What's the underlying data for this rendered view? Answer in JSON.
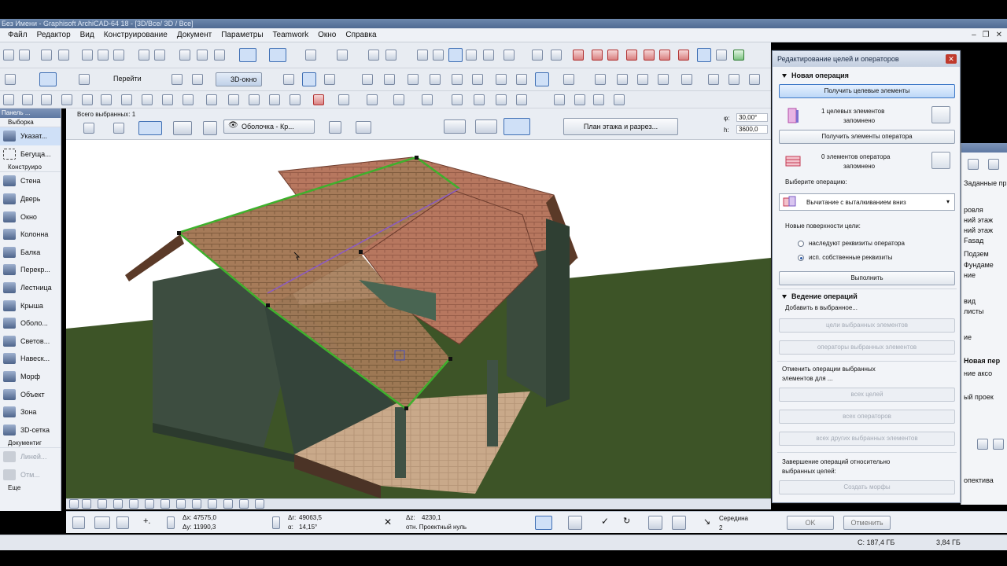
{
  "window": {
    "title": "Без Имени - Graphisoft ArchiCAD-64 18 - [3D/Все/ 3D / Все]"
  },
  "menu": [
    "Файл",
    "Редактор",
    "Вид",
    "Конструирование",
    "Документ",
    "Параметры",
    "Teamwork",
    "Окно",
    "Справка"
  ],
  "toolbar": {
    "navigate_label": "Перейти",
    "view3d_label": "3D-окно",
    "floorplan_label": "План этажа и разрез..."
  },
  "infobox": {
    "selected": "Всего выбранных: 1",
    "shell_label": "Оболочка - Кр...",
    "angle_label": "φ:",
    "angle_value": "30,00°",
    "height_label": "h:",
    "height_value": "3600,0"
  },
  "toolbox": {
    "header": "Панель ...",
    "select_section": "Выборка",
    "items_top": [
      {
        "label": "Указат...",
        "selected": true
      },
      {
        "label": "Бегуща...",
        "selected": false
      }
    ],
    "design_section": "Конструиро",
    "design_items": [
      "Стена",
      "Дверь",
      "Окно",
      "Колонна",
      "Балка",
      "Перекр...",
      "Лестница",
      "Крыша",
      "Оболо...",
      "Светов...",
      "Навеск...",
      "Морф",
      "Объект",
      "Зона",
      "3D-сетка"
    ],
    "doc_section": "Документиг",
    "doc_items": [
      "Линей...",
      "Отм..."
    ],
    "more": "Еще"
  },
  "coordbar": {
    "ax_label": "Δx:",
    "ax_value": "47575,0",
    "ay_label": "Δy:",
    "ay_value": "11990,3",
    "r_label": "Δr:",
    "r_value": "49063,5",
    "a_label": "α:",
    "a_value": "14,15°",
    "z_label": "Δz:",
    "z_value": "4230,1",
    "ref_label": "отн. Проектный нуль",
    "snap_label": "Середина",
    "snap_value": "2",
    "ok_label": "OK",
    "cancel_label": "Отменить"
  },
  "statusbar": {
    "disk_c": "C: 187,4 ГБ",
    "disk_mem": "3,84 ГБ"
  },
  "dialog": {
    "title": "Редактирование целей и операторов",
    "new_op_header": "Новая операция",
    "get_targets_btn": "Получить целевые элементы",
    "targets_count_line1": "1 целевых элементов",
    "targets_count_line2": "запомнено",
    "get_operators_btn": "Получить элементы оператора",
    "operators_count_line1": "0 элементов оператора",
    "operators_count_line2": "запомнено",
    "choose_op_label": "Выберите операцию:",
    "op_value": "Вычитание с выталкиванием вниз",
    "new_surfaces_label": "Новые поверхности цели:",
    "radio_inherit": "наследуют реквизиты оператора",
    "radio_own": "исп. собственные реквизиты",
    "execute_btn": "Выполнить",
    "manage_header": "Ведение операций",
    "add_to_sel_label": "Добавить в выбранное...",
    "sel_targets_btn": "цели выбранных элементов",
    "sel_operators_btn": "операторы выбранных элементов",
    "cancel_ops_line1": "Отменить операции выбранных",
    "cancel_ops_line2": "элементов для ...",
    "all_targets_btn": "всех целей",
    "all_operators_btn": "всех операторов",
    "all_others_btn": "всех других выбранных элементов",
    "finish_line1": "Завершение операций относительно",
    "finish_line2": "выбранных целей:",
    "create_morphs_btn": "Создать морфы"
  },
  "right_panel": {
    "lines": [
      "Заданные прое",
      "ровля",
      "ний этаж",
      "ний этаж",
      "Fasaд",
      "Подзем",
      "Фундаме",
      "ние",
      "вид",
      "листы",
      "ие",
      "Новая пер",
      "ние аксо",
      "ый проек",
      "опектива"
    ]
  }
}
